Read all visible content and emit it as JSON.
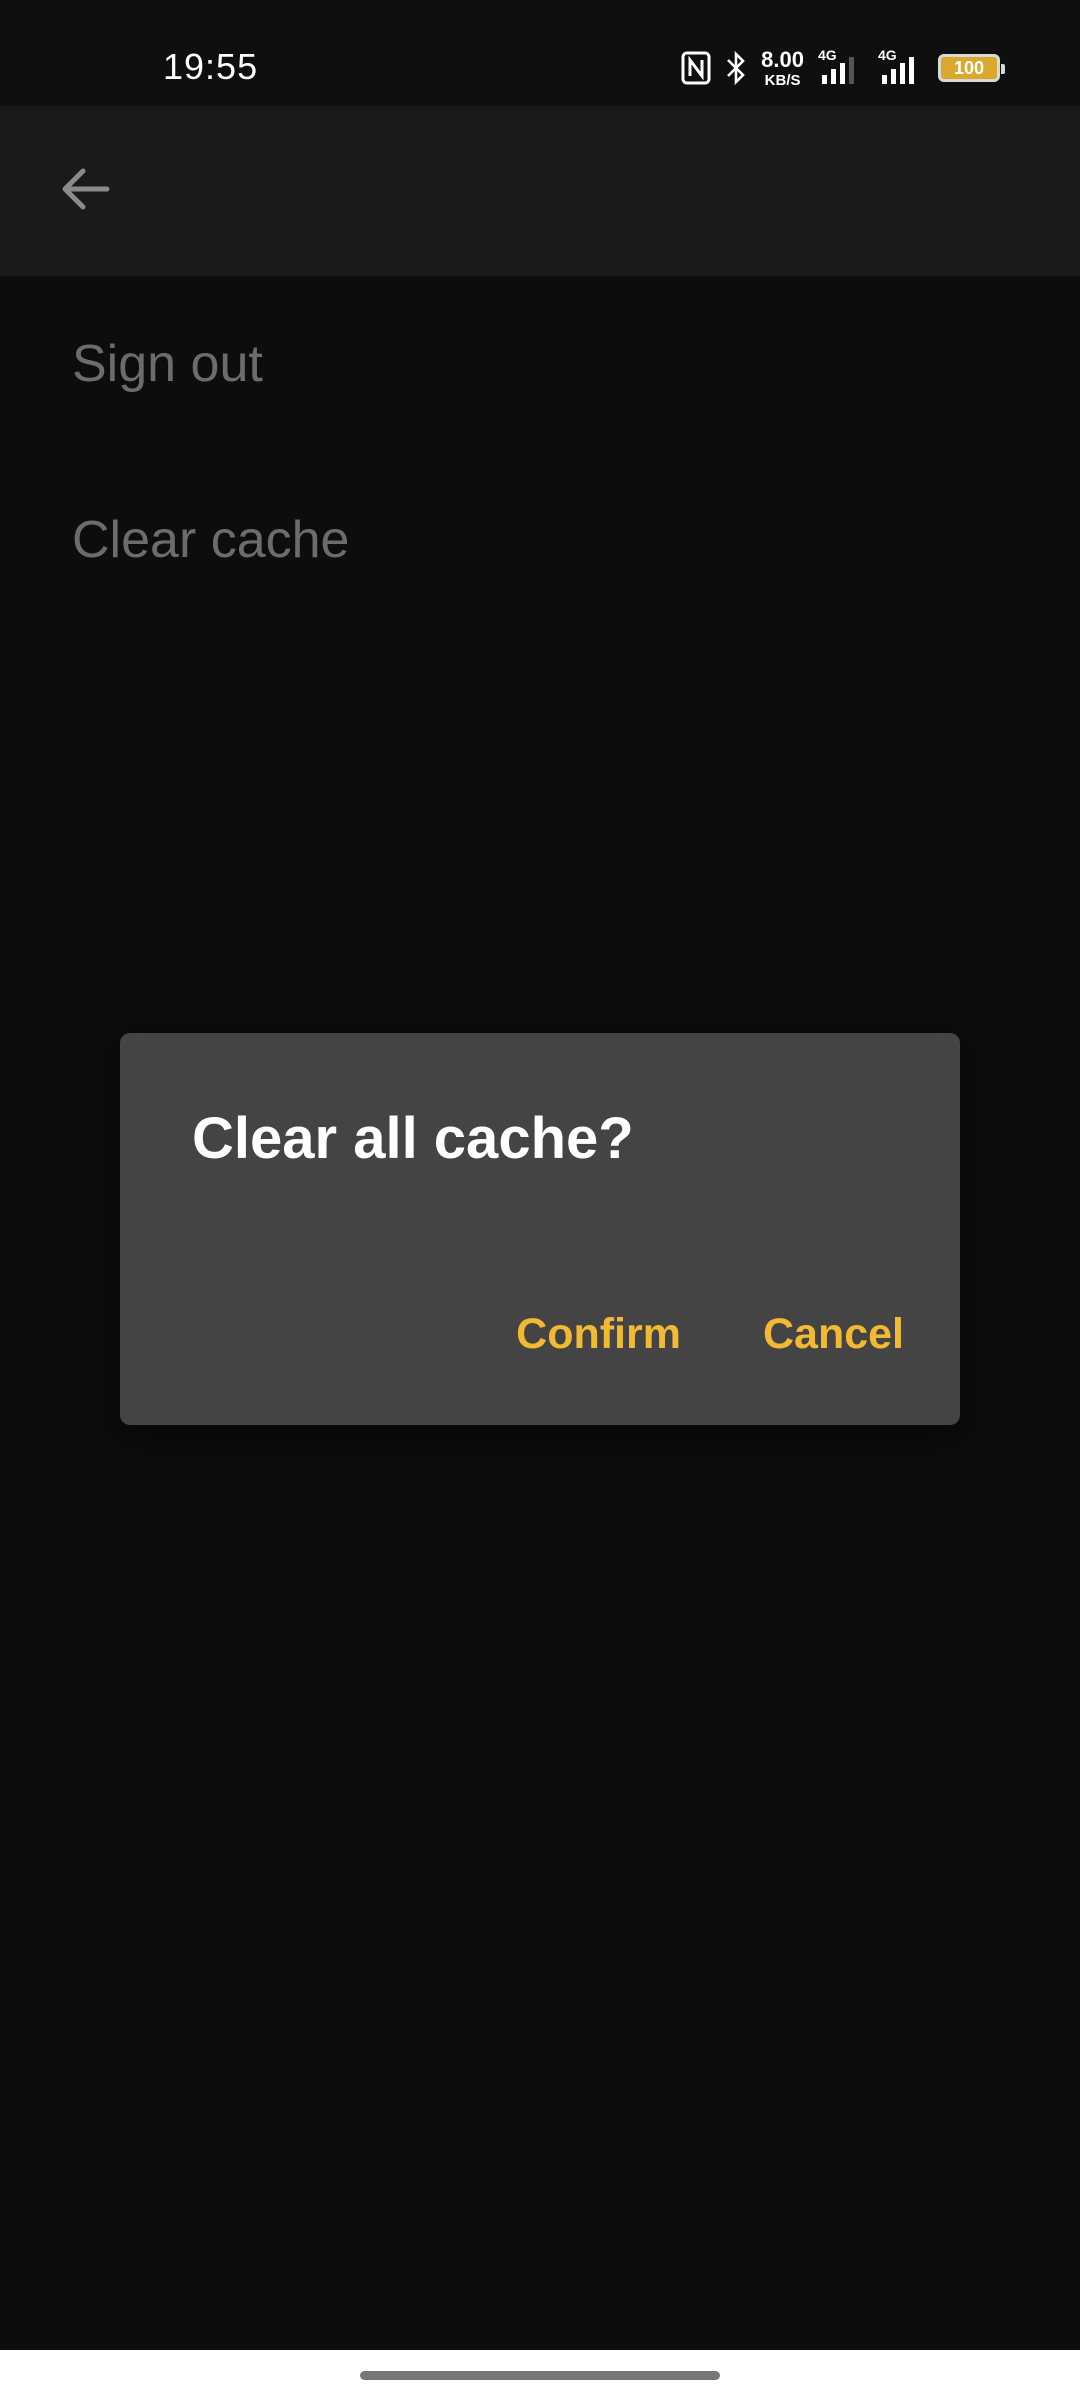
{
  "status_bar": {
    "time": "19:55",
    "net_speed_value": "8.00",
    "net_speed_unit": "KB/S",
    "signal_1_label": "4G",
    "signal_2_label": "4G",
    "battery_level": "100",
    "icons": [
      "nfc-icon",
      "bluetooth-icon",
      "signal-icon",
      "signal-icon",
      "battery-icon"
    ]
  },
  "app_bar": {
    "back_icon": "arrow-left-icon"
  },
  "settings": {
    "items": [
      {
        "label": "Sign out"
      },
      {
        "label": "Clear cache"
      }
    ]
  },
  "dialog": {
    "title": "Clear all cache?",
    "confirm_label": "Confirm",
    "cancel_label": "Cancel"
  },
  "colors": {
    "accent": "#f2b933",
    "dialog_bg": "#444444",
    "page_bg": "#0d0d0d",
    "app_bar_bg": "#1a1a1a",
    "muted_text": "#6c6c6c"
  }
}
